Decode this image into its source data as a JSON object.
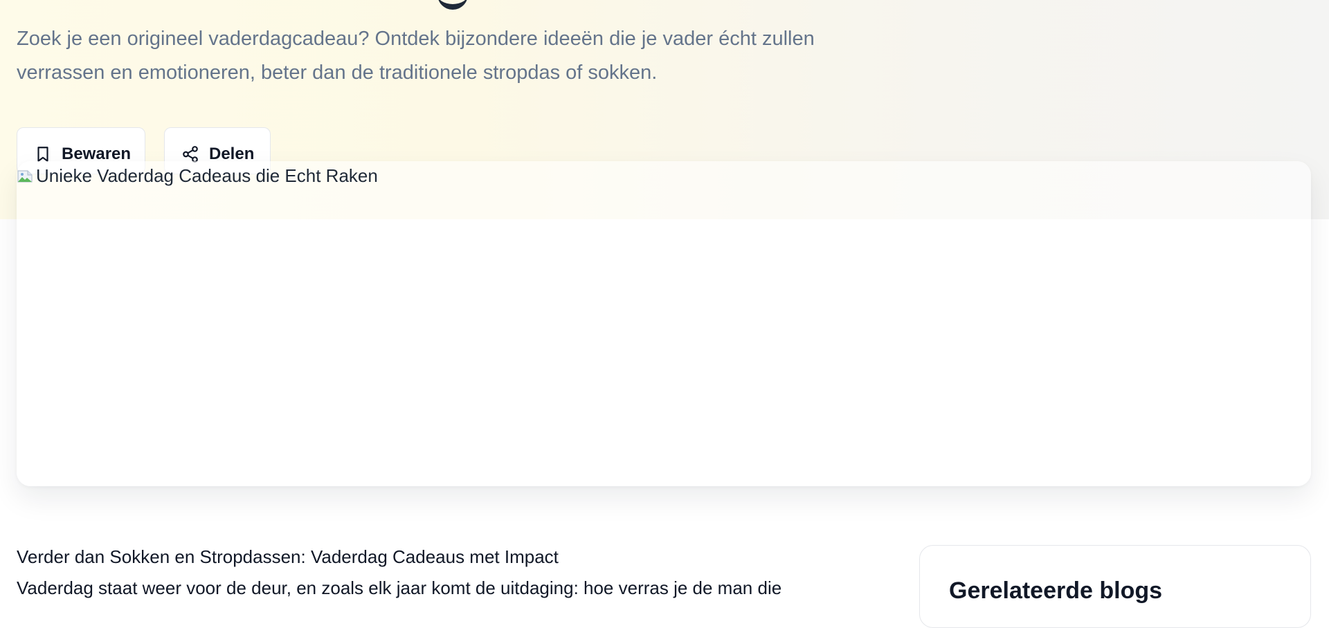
{
  "hero": {
    "subtitle_line1": "Zoek je een origineel vaderdagcadeau? Ontdek bijzondere ideeën die je vader écht zullen",
    "subtitle_line2": "verrassen en emotioneren, beter dan de traditionele stropdas of sokken."
  },
  "actions": {
    "save_label": "Bewaren",
    "save_icon": "bookmark-icon",
    "share_label": "Delen",
    "share_icon": "share-icon"
  },
  "featured_image": {
    "alt": "Unieke Vaderdag Cadeaus die Echt Raken",
    "icon": "broken-image-icon"
  },
  "article": {
    "heading": "Verder dan Sokken en Stropdassen: Vaderdag Cadeaus met Impact",
    "paragraph": "Vaderdag staat weer voor de deur, en zoals elk jaar komt de uitdaging: hoe verras je de man die"
  },
  "sidebar": {
    "related_title": "Gerelateerde blogs"
  },
  "colors": {
    "hero_background": "#fdf9e6",
    "subtitle_text": "#64748b",
    "primary_text": "#111827",
    "border": "#e5e7eb"
  }
}
